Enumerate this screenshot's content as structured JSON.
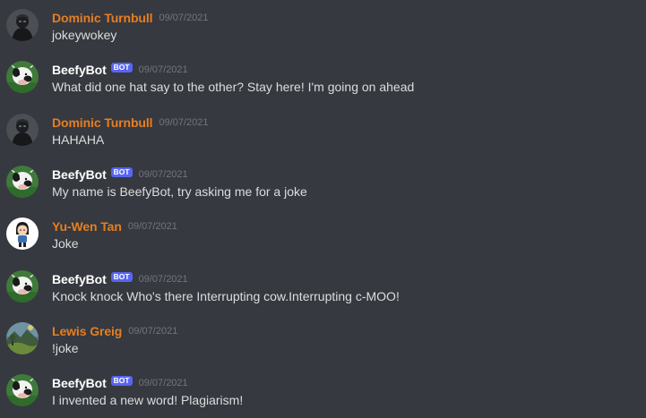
{
  "colors": {
    "background": "#36393f",
    "message_text": "#dcddde",
    "timestamp": "#72767d",
    "bot_username": "#ffffff",
    "user_username": "#e67e22",
    "bot_badge": "#5865f2"
  },
  "messages": [
    {
      "username": "Dominic Turnbull",
      "is_bot": false,
      "avatar_icon": "avatar-dark-figure",
      "timestamp": "09/07/2021",
      "text": "jokeywokey"
    },
    {
      "username": "BeefyBot",
      "is_bot": true,
      "bot_tag": "BOT",
      "avatar_icon": "avatar-cow",
      "timestamp": "09/07/2021",
      "text": "What did one hat say to the other? Stay here! I'm going on ahead"
    },
    {
      "username": "Dominic Turnbull",
      "is_bot": false,
      "avatar_icon": "avatar-dark-figure",
      "timestamp": "09/07/2021",
      "text": "HAHAHA"
    },
    {
      "username": "BeefyBot",
      "is_bot": true,
      "bot_tag": "BOT",
      "avatar_icon": "avatar-cow",
      "timestamp": "09/07/2021",
      "text": "My name is BeefyBot, try asking me for a joke"
    },
    {
      "username": "Yu-Wen Tan",
      "is_bot": false,
      "avatar_icon": "avatar-cartoon-girl",
      "timestamp": "09/07/2021",
      "text": "Joke"
    },
    {
      "username": "BeefyBot",
      "is_bot": true,
      "bot_tag": "BOT",
      "avatar_icon": "avatar-cow",
      "timestamp": "09/07/2021",
      "text": "Knock knock Who's there Interrupting cow.Interrupting c-MOO!"
    },
    {
      "username": "Lewis Greig",
      "is_bot": false,
      "avatar_icon": "avatar-landscape",
      "timestamp": "09/07/2021",
      "text": "!joke"
    },
    {
      "username": "BeefyBot",
      "is_bot": true,
      "bot_tag": "BOT",
      "avatar_icon": "avatar-cow",
      "timestamp": "09/07/2021",
      "text": "I invented a new word! Plagiarism!"
    }
  ]
}
